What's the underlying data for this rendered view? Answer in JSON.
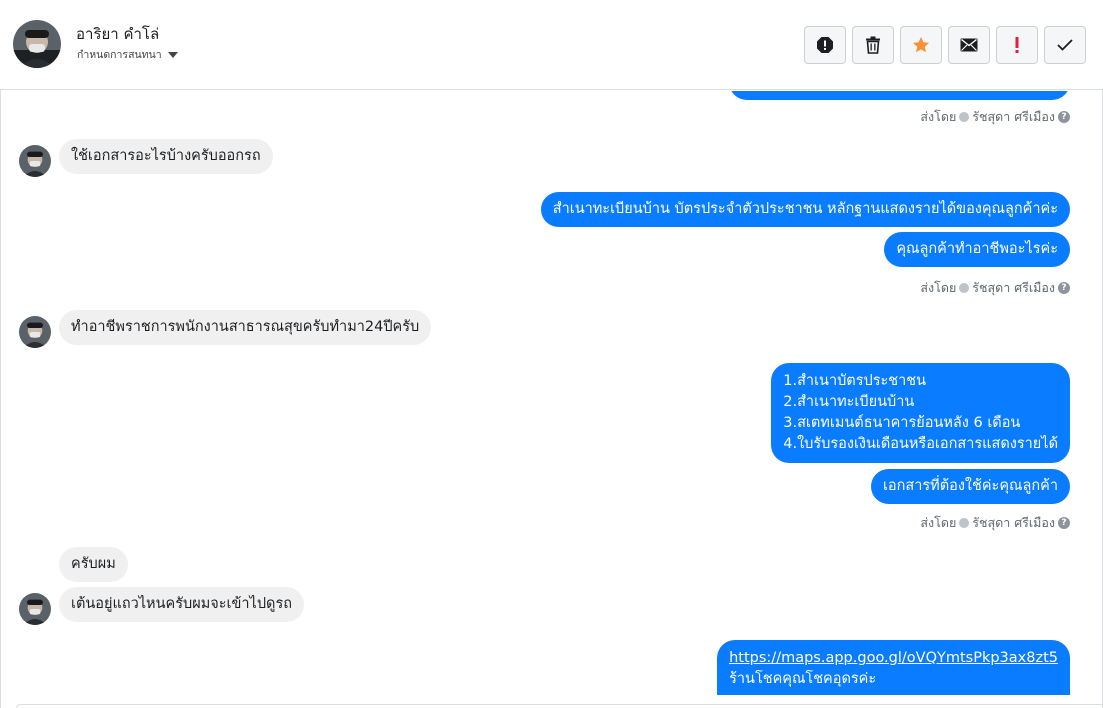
{
  "header": {
    "name": "อาริยา คำโล่",
    "sub_label": "กำหนดการสนทนา"
  },
  "actions": [
    {
      "name": "report-icon"
    },
    {
      "name": "trash-icon"
    },
    {
      "name": "star-icon",
      "color": "#f7923a"
    },
    {
      "name": "envelope-icon"
    },
    {
      "name": "exclamation-icon",
      "color": "#e41e3f"
    },
    {
      "name": "checkmark-icon"
    }
  ],
  "sent_by": {
    "prefix": "ส่งโดย",
    "agent": "รัชสุดา ศรีเมือง",
    "help": "?"
  },
  "messages": {
    "m1": "ใช้เอกสารอะไรบ้างครับออกรถ",
    "m2": "สำเนาทะเบียนบ้าน บัตรประจำตัวประชาชน หลักฐานแสดงรายได้ของคุณลูกค้าค่ะ",
    "m3": "คุณลูกค้าทำอาชีพอะไรค่ะ",
    "m4": "ทำอาชีพราชการพนักงานสาธารณสุขครับทำมา24ปีครับ",
    "m5_lines": [
      "1.สำเนาบัตรประชาชน",
      "2.สำเนาทะเบียนบ้าน",
      "3.สเตทเมนต์ธนาคารย้อนหลัง 6 เดือน",
      "4.ใบรับรองเงินเดือนหรือเอกสารแสดงรายได้"
    ],
    "m6": "เอกสารที่ต้องใช้ค่ะคุณลูกค้า",
    "m7": "ครับผม",
    "m8": "เต้นอยู่แถวไหนครับผมจะเข้าไปดูรถ",
    "m9_link": "https://maps.app.goo.gl/oVQYmtsPkp3ax8zt5",
    "m9_text": "ร้านโชคคุณโชคอุดรค่ะ"
  },
  "colors": {
    "outgoing": "#0a7cff",
    "incoming": "#f0f0f0"
  }
}
